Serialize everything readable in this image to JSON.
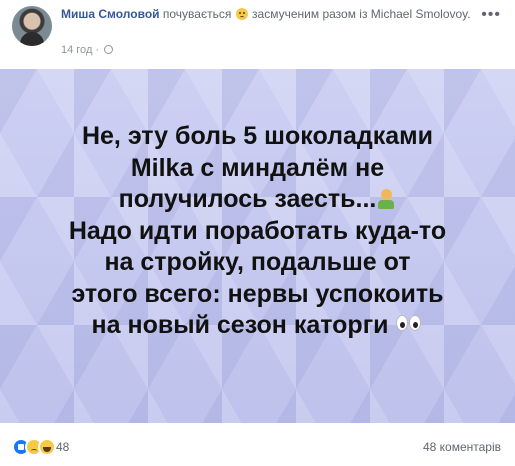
{
  "post": {
    "author": "Миша Смоловой",
    "feeling_text": "почувається",
    "feeling_emoji": "upset-face-emoji",
    "feeling_word": "засмученим",
    "with_text": "разом із",
    "tagged": "Michael Smolovoy.",
    "time": "14 год",
    "time_separator": "·",
    "privacy_icon": "globe-icon",
    "more_label": "•••"
  },
  "image": {
    "background_color": "#c4c8ee",
    "lines": [
      "Не, эту боль 5 шоколадками",
      "Milka с миндалём не",
      "получилось заесть...",
      "Надо идти поработать куда-то",
      "на стройку, подальше от",
      "этого всего: нервы успокоить",
      "на новый сезон каторги"
    ],
    "emojis": [
      "person-shrugging-emoji",
      "eyes-emoji"
    ]
  },
  "footer": {
    "reaction_icons": [
      "like-icon",
      "sad-icon",
      "haha-icon"
    ],
    "reaction_count": "48",
    "comments": "48 коментарів"
  },
  "colors": {
    "link": "#365899",
    "meta": "#616770",
    "like": "#1877f2"
  }
}
